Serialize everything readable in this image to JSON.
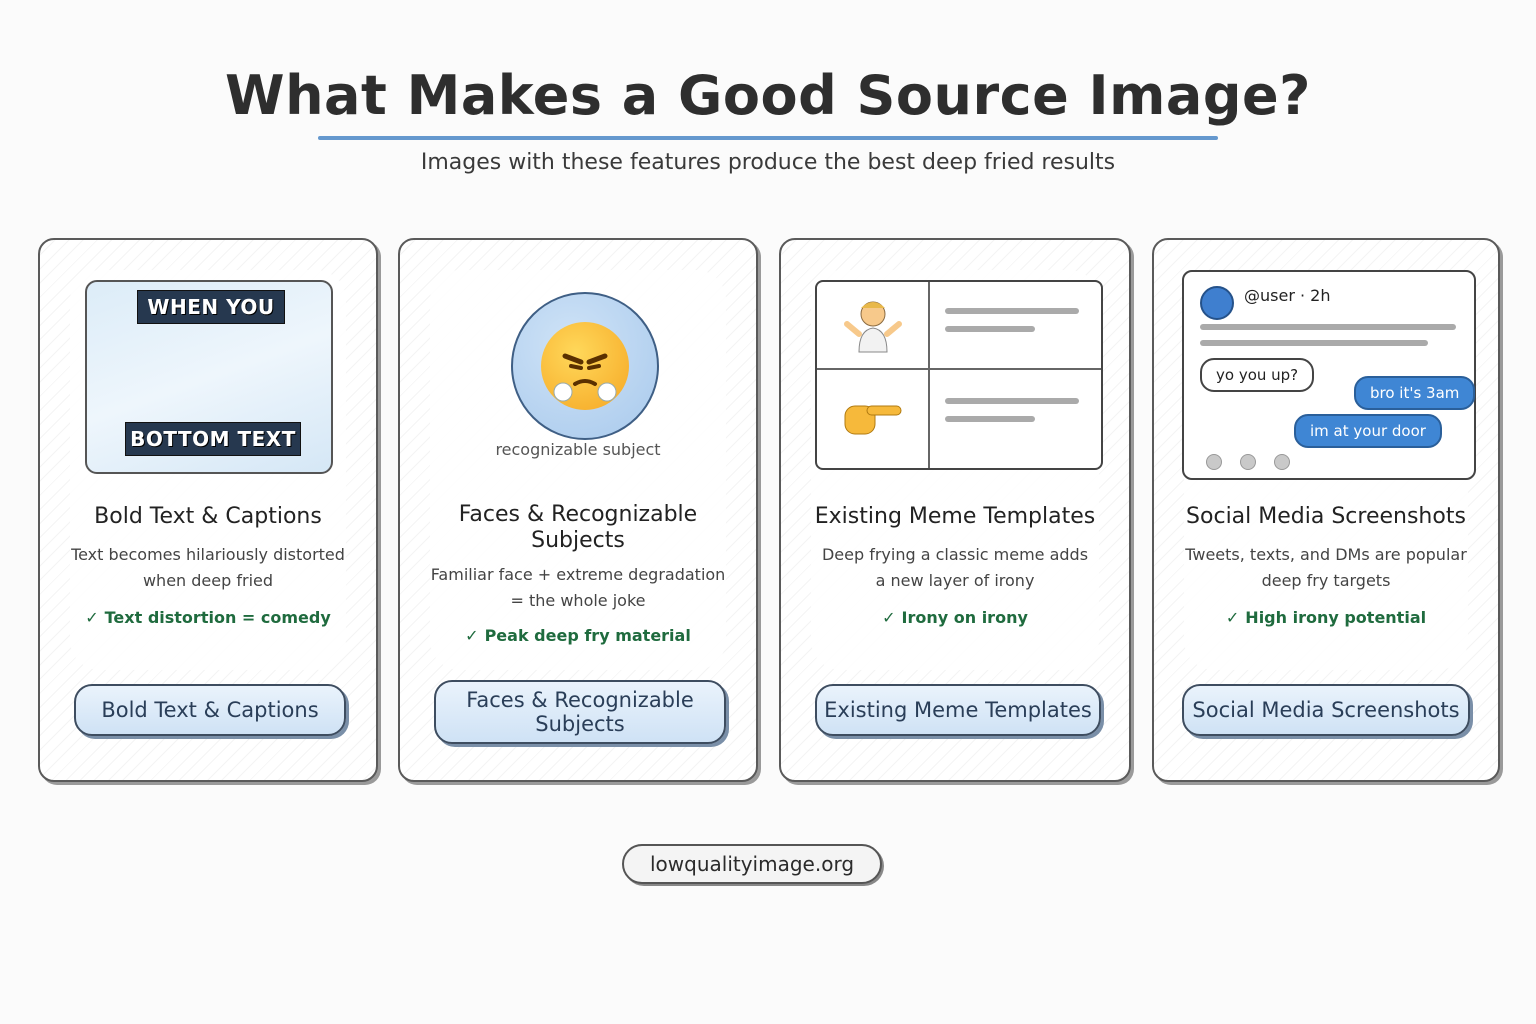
{
  "header": {
    "title": "What Makes a Good Source Image?",
    "subtitle": "Images with these features produce the best deep fried results"
  },
  "cards": [
    {
      "title": "Bold Text & Captions",
      "description": "Text becomes hilariously distorted when deep fried",
      "check": "Text distortion = comedy",
      "button_label": "Bold Text & Captions",
      "illustration": {
        "top_caption": "WHEN YOU",
        "bottom_caption": "BOTTOM TEXT"
      }
    },
    {
      "title": "Faces & Recognizable Subjects",
      "description": "Familiar face + extreme degradation = the whole joke",
      "check": "Peak deep fry material",
      "button_label": "Faces & Recognizable Subjects",
      "illustration": {
        "icon": "angry-face-emoji-icon",
        "caption": "recognizable subject"
      }
    },
    {
      "title": "Existing Meme Templates",
      "description": "Deep frying a classic meme adds a new layer of irony",
      "check": "Irony on irony",
      "button_label": "Existing Meme Templates",
      "illustration": {
        "icons": [
          "shrug-person-icon",
          "pointing-hand-icon"
        ]
      }
    },
    {
      "title": "Social Media Screenshots",
      "description": "Tweets, texts, and DMs are popular deep fry targets",
      "check": "High irony potential",
      "button_label": "Social Media Screenshots",
      "illustration": {
        "handle": "@user · 2h",
        "messages": [
          {
            "side": "in",
            "text": "yo you up?"
          },
          {
            "side": "out",
            "text": "bro it's 3am"
          },
          {
            "side": "out",
            "text": "im at your door"
          }
        ]
      }
    }
  ],
  "footer": {
    "site": "lowqualityimage.org"
  },
  "colors": {
    "accent": "#4a86c5",
    "check_green": "#1f6b3e",
    "button_bg": "#cfe2f5",
    "bubble_blue": "#3f86d4"
  }
}
